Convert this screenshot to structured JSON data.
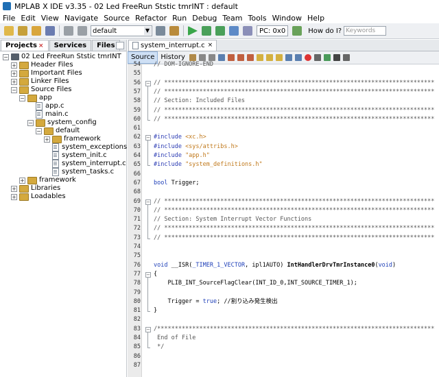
{
  "window": {
    "title": "MPLAB X IDE v3.35 - 02 Led FreeRun Ststic tmrINT : default"
  },
  "menu": [
    "File",
    "Edit",
    "View",
    "Navigate",
    "Source",
    "Refactor",
    "Run",
    "Debug",
    "Team",
    "Tools",
    "Window",
    "Help"
  ],
  "toolbar": {
    "config_value": "default",
    "pc_label": "PC: 0x0",
    "howdoi_label": "How do I?",
    "search_placeholder": "Keywords"
  },
  "left_tabs": [
    {
      "label": "Projects",
      "closable": true
    },
    {
      "label": "Services"
    },
    {
      "label": "Files"
    }
  ],
  "tree": [
    {
      "label": "02 Led FreeRun Ststic tmrINT",
      "expander": "−",
      "icon": "project"
    },
    {
      "label": "Header Files",
      "expander": "+",
      "icon": "folder"
    },
    {
      "label": "Important Files",
      "expander": "+",
      "icon": "folder"
    },
    {
      "label": "Linker Files",
      "expander": "+",
      "icon": "folder"
    },
    {
      "label": "Source Files",
      "expander": "−",
      "icon": "folder"
    },
    {
      "label": "app",
      "expander": "−",
      "icon": "folder"
    },
    {
      "label": "app.c",
      "icon": "file"
    },
    {
      "label": "main.c",
      "icon": "file"
    },
    {
      "label": "system_config",
      "expander": "−",
      "icon": "folder"
    },
    {
      "label": "default",
      "expander": "−",
      "icon": "folder"
    },
    {
      "label": "framework",
      "expander": "+",
      "icon": "folder"
    },
    {
      "label": "system_exceptions.c",
      "icon": "file"
    },
    {
      "label": "system_init.c",
      "icon": "file"
    },
    {
      "label": "system_interrupt.c",
      "icon": "file"
    },
    {
      "label": "system_tasks.c",
      "icon": "file"
    },
    {
      "label": "framework",
      "expander": "+",
      "icon": "folder"
    },
    {
      "label": "Libraries",
      "expander": "+",
      "icon": "folder"
    },
    {
      "label": "Loadables",
      "expander": "+",
      "icon": "folder"
    }
  ],
  "editor": {
    "tab_label": "system_interrupt.c",
    "source_label": "Source",
    "history_label": "History",
    "lines": [
      {
        "n": "54",
        "t": "// DOM-IGNORE-END",
        "c": "cm"
      },
      {
        "n": "55",
        "t": ""
      },
      {
        "n": "56",
        "t": "// *****************************************************************************",
        "c": "cm",
        "fold": "−"
      },
      {
        "n": "57",
        "t": "// *****************************************************************************",
        "c": "cm"
      },
      {
        "n": "58",
        "t": "// Section: Included Files",
        "c": "cm"
      },
      {
        "n": "59",
        "t": "// *****************************************************************************",
        "c": "cm"
      },
      {
        "n": "60",
        "t": "// *****************************************************************************",
        "c": "cm"
      },
      {
        "n": "61",
        "t": ""
      },
      {
        "n": "62",
        "t": "#include <xc.h>",
        "c": "pp",
        "fold": "−"
      },
      {
        "n": "63",
        "t": "#include <sys/attribs.h>",
        "c": "pp"
      },
      {
        "n": "64",
        "t": "#include \"app.h\"",
        "c": "pp"
      },
      {
        "n": "65",
        "t": "#include \"system_definitions.h\"",
        "c": "pp"
      },
      {
        "n": "66",
        "t": ""
      },
      {
        "n": "67",
        "t": "bool Trigger;",
        "c": "mix1"
      },
      {
        "n": "68",
        "t": ""
      },
      {
        "n": "69",
        "t": "// *****************************************************************************",
        "c": "cm",
        "fold": "−"
      },
      {
        "n": "70",
        "t": "// *****************************************************************************",
        "c": "cm"
      },
      {
        "n": "71",
        "t": "// Section: System Interrupt Vector Functions",
        "c": "cm"
      },
      {
        "n": "72",
        "t": "// *****************************************************************************",
        "c": "cm"
      },
      {
        "n": "73",
        "t": "// *****************************************************************************",
        "c": "cm"
      },
      {
        "n": "74",
        "t": ""
      },
      {
        "n": "75",
        "t": ""
      },
      {
        "n": "76",
        "t": "void __ISR(_TIMER_1_VECTOR, ipl1AUTO) IntHandlerDrvTmrInstance0(void)",
        "c": "mix2"
      },
      {
        "n": "77",
        "t": "{",
        "fold": "−"
      },
      {
        "n": "78",
        "t": "    PLIB_INT_SourceFlagClear(INT_ID_0,INT_SOURCE_TIMER_1);"
      },
      {
        "n": "79",
        "t": ""
      },
      {
        "n": "80",
        "t": "    Trigger = true; //割り込み発生検出",
        "c": "mix3"
      },
      {
        "n": "81",
        "t": "}"
      },
      {
        "n": "82",
        "t": ""
      },
      {
        "n": "83",
        "t": "/*******************************************************************************",
        "c": "cm",
        "fold": "−"
      },
      {
        "n": "84",
        "t": " End of File",
        "c": "cm"
      },
      {
        "n": "85",
        "t": " */",
        "c": "cm"
      },
      {
        "n": "86",
        "t": ""
      },
      {
        "n": "87",
        "t": ""
      }
    ]
  },
  "colors": {
    "accent": "#1f6fb5",
    "comment": "#555555",
    "preprocessor": "#2b3bb3",
    "keyword": "#1e3fb8",
    "string": "#c0781a"
  }
}
